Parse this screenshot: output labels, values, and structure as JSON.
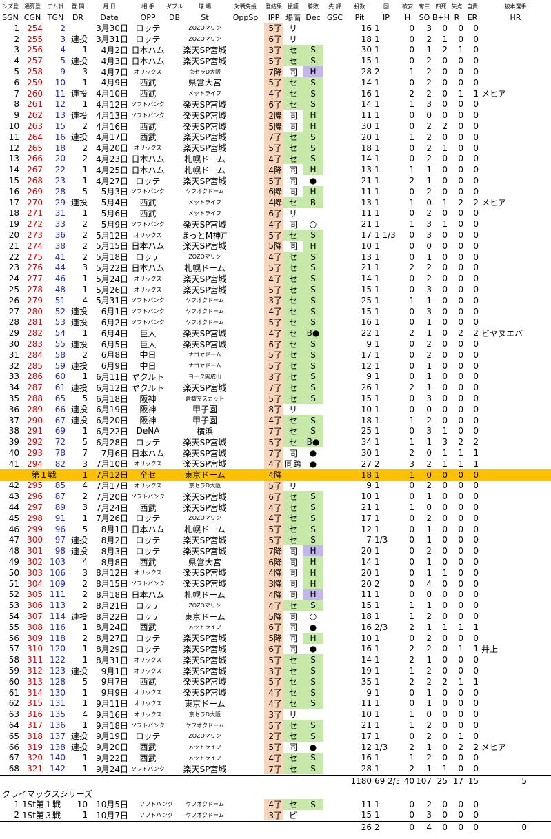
{
  "header_top": [
    "シズ登",
    "通算登",
    "チム試",
    "登 間",
    "月 日",
    "相 手",
    "ダブル",
    "球 場",
    "対戦先投",
    "登結果",
    "援護",
    "勝敗",
    "先 評",
    "投数",
    "回",
    "被安",
    "奪三",
    "四死",
    "失点",
    "自責",
    "被本選手"
  ],
  "header_bottom": [
    "SGN",
    "CGN",
    "TGN",
    "DR",
    "Date",
    "OPP",
    "DB",
    "St",
    "OppSp",
    "IPP",
    "場面",
    "Dec",
    "GSC",
    "Pit",
    "IP",
    "H",
    "SO",
    "B+H",
    "R",
    "ER",
    "HR"
  ],
  "rows": [
    [
      "1",
      "254",
      "2",
      "",
      "3月30日",
      "ロッテ",
      "",
      "ZOZOマリン",
      "",
      "5了",
      "リ",
      "",
      "",
      "16",
      "1",
      "0",
      "3",
      "0",
      "0",
      "0",
      ""
    ],
    [
      "2",
      "255",
      "3",
      "連投",
      "3月31日",
      "ロッテ",
      "",
      "ZOZOマリン",
      "",
      "6了",
      "リ",
      "",
      "",
      "18",
      "1",
      "0",
      "2",
      "1",
      "0",
      "0",
      ""
    ],
    [
      "3",
      "256",
      "4",
      "1",
      "4月2日",
      "日本ハム",
      "",
      "楽天SP宮城",
      "",
      "3了",
      "セ",
      "S",
      "",
      "30",
      "1",
      "0",
      "1",
      "2",
      "1",
      "0",
      ""
    ],
    [
      "4",
      "257",
      "5",
      "連投",
      "4月3日",
      "日本ハム",
      "",
      "楽天SP宮城",
      "",
      "5了",
      "セ",
      "S",
      "",
      "15",
      "1",
      "0",
      "2",
      "0",
      "0",
      "0",
      ""
    ],
    [
      "5",
      "258",
      "9",
      "3",
      "4月7日",
      "オリックス",
      "",
      "京セラD大阪",
      "",
      "7降",
      "同",
      "H",
      "",
      "28",
      "2",
      "1",
      "2",
      "0",
      "0",
      "0",
      ""
    ],
    [
      "6",
      "259",
      "10",
      "1",
      "4月9日",
      "西武",
      "",
      "県営大宮",
      "",
      "5了",
      "セ",
      "S",
      "",
      "14",
      "1",
      "0",
      "2",
      "0",
      "0",
      "0",
      ""
    ],
    [
      "7",
      "260",
      "11",
      "連投",
      "4月10日",
      "西武",
      "",
      "メットライフ",
      "",
      "4了",
      "セ",
      "S",
      "",
      "16",
      "1",
      "2",
      "2",
      "0",
      "1",
      "1",
      "メヒア"
    ],
    [
      "8",
      "261",
      "12",
      "1",
      "4月12日",
      "ソフトバンク",
      "",
      "楽天SP宮城",
      "",
      "6了",
      "セ",
      "S",
      "",
      "14",
      "1",
      "1",
      "3",
      "0",
      "0",
      "0",
      ""
    ],
    [
      "9",
      "262",
      "13",
      "連投",
      "4月13日",
      "ソフトバンク",
      "",
      "楽天SP宮城",
      "",
      "2降",
      "同",
      "H",
      "",
      "11",
      "1",
      "0",
      "0",
      "0",
      "0",
      "0",
      ""
    ],
    [
      "10",
      "263",
      "15",
      "2",
      "4月16日",
      "西武",
      "",
      "楽天SP宮城",
      "",
      "5降",
      "同",
      "H",
      "",
      "30",
      "1",
      "0",
      "2",
      "2",
      "0",
      "0",
      ""
    ],
    [
      "11",
      "264",
      "16",
      "連投",
      "4月17日",
      "西武",
      "",
      "楽天SP宮城",
      "",
      "7了",
      "セ",
      "S",
      "",
      "20",
      "1",
      "1",
      "2",
      "0",
      "0",
      "0",
      ""
    ],
    [
      "12",
      "265",
      "18",
      "2",
      "4月20日",
      "オリックス",
      "",
      "楽天SP宮城",
      "",
      "5了",
      "セ",
      "S",
      "",
      "18",
      "1",
      "0",
      "2",
      "1",
      "0",
      "0",
      ""
    ],
    [
      "13",
      "266",
      "20",
      "2",
      "4月23日",
      "日本ハム",
      "",
      "札幌ドーム",
      "",
      "4了",
      "セ",
      "S",
      "",
      "14",
      "1",
      "0",
      "2",
      "0",
      "0",
      "0",
      ""
    ],
    [
      "14",
      "267",
      "22",
      "1",
      "4月25日",
      "日本ハム",
      "",
      "札幌ドーム",
      "",
      "4降",
      "同",
      "H",
      "",
      "13",
      "1",
      "1",
      "1",
      "0",
      "0",
      "0",
      ""
    ],
    [
      "15",
      "268",
      "23",
      "1",
      "4月27日",
      "ロッテ",
      "",
      "楽天SP宮城",
      "",
      "5了",
      "同",
      "●",
      "",
      "21",
      "1",
      "2",
      "1",
      "0",
      "0",
      "0",
      ""
    ],
    [
      "16",
      "269",
      "28",
      "5",
      "5月3日",
      "ソフトバンク",
      "",
      "ヤフオクドーム",
      "",
      "6降",
      "同",
      "H",
      "",
      "11",
      "1",
      "0",
      "2",
      "0",
      "0",
      "0",
      ""
    ],
    [
      "17",
      "270",
      "29",
      "連投",
      "5月4日",
      "西武",
      "",
      "メットライフ",
      "",
      "4降",
      "セ",
      "B",
      "",
      "13",
      "1",
      "1",
      "0",
      "1",
      "2",
      "2",
      "メヒア"
    ],
    [
      "18",
      "271",
      "31",
      "1",
      "5月6日",
      "西武",
      "",
      "メットライフ",
      "",
      "6了",
      "リ",
      "",
      "",
      "11",
      "1",
      "0",
      "2",
      "0",
      "0",
      "0",
      ""
    ],
    [
      "19",
      "272",
      "33",
      "2",
      "5月9日",
      "ソフトバンク",
      "",
      "楽天SP宮城",
      "",
      "4了",
      "同",
      "○",
      "",
      "21",
      "1",
      "1",
      "3",
      "1",
      "0",
      "0",
      ""
    ],
    [
      "20",
      "273",
      "36",
      "2",
      "5月12日",
      "オリックス",
      "",
      "ほっとM神戸",
      "",
      "5了",
      "セ",
      "S",
      "",
      "17",
      "1 1/3",
      "0",
      "3",
      "0",
      "0",
      "0",
      ""
    ],
    [
      "21",
      "274",
      "38",
      "2",
      "5月15日",
      "日本ハム",
      "",
      "楽天SP宮城",
      "",
      "5降",
      "同",
      "H",
      "",
      "10",
      "1",
      "0",
      "0",
      "0",
      "0",
      "0",
      ""
    ],
    [
      "22",
      "275",
      "41",
      "2",
      "5月18日",
      "ロッテ",
      "",
      "ZOZOマリン",
      "",
      "4了",
      "セ",
      "S",
      "",
      "13",
      "1",
      "0",
      "1",
      "0",
      "0",
      "0",
      ""
    ],
    [
      "23",
      "276",
      "44",
      "3",
      "5月22日",
      "日本ハム",
      "",
      "札幌ドーム",
      "",
      "5了",
      "セ",
      "S",
      "",
      "21",
      "1",
      "2",
      "2",
      "0",
      "0",
      "0",
      ""
    ],
    [
      "24",
      "277",
      "46",
      "1",
      "5月24日",
      "オリックス",
      "",
      "楽天SP宮城",
      "",
      "4了",
      "セ",
      "S",
      "",
      "14",
      "1",
      "0",
      "2",
      "0",
      "0",
      "0",
      ""
    ],
    [
      "25",
      "278",
      "48",
      "1",
      "5月26日",
      "オリックス",
      "",
      "楽天SP宮城",
      "",
      "5了",
      "セ",
      "S",
      "",
      "15",
      "1",
      "0",
      "3",
      "0",
      "0",
      "0",
      ""
    ],
    [
      "26",
      "279",
      "51",
      "4",
      "5月31日",
      "ソフトバンク",
      "",
      "ヤフオクドーム",
      "",
      "3了",
      "セ",
      "S",
      "",
      "25",
      "1",
      "1",
      "1",
      "0",
      "0",
      "0",
      ""
    ],
    [
      "27",
      "280",
      "52",
      "連投",
      "6月1日",
      "ソフトバンク",
      "",
      "ヤフオクドーム",
      "",
      "4了",
      "セ",
      "S",
      "",
      "15",
      "1",
      "0",
      "3",
      "0",
      "0",
      "0",
      ""
    ],
    [
      "28",
      "281",
      "53",
      "連投",
      "6月2日",
      "ソフトバンク",
      "",
      "ヤフオクドーム",
      "",
      "5了",
      "セ",
      "S",
      "",
      "16",
      "1",
      "0",
      "1",
      "0",
      "0",
      "0",
      ""
    ],
    [
      "29",
      "282",
      "54",
      "1",
      "6月4日",
      "巨人",
      "",
      "楽天SP宮城",
      "",
      "4了",
      "セ",
      "B●",
      "",
      "22",
      "1",
      "2",
      "1",
      "0",
      "2",
      "2",
      "ビヤヌエバ"
    ],
    [
      "30",
      "283",
      "55",
      "連投",
      "6月5日",
      "巨人",
      "",
      "楽天SP宮城",
      "",
      "6了",
      "セ",
      "S",
      "",
      "9",
      "1",
      "0",
      "2",
      "0",
      "0",
      "0",
      ""
    ],
    [
      "31",
      "284",
      "58",
      "2",
      "6月8日",
      "中日",
      "",
      "ナゴヤドーム",
      "",
      "5了",
      "セ",
      "S",
      "",
      "17",
      "1",
      "0",
      "2",
      "0",
      "0",
      "0",
      ""
    ],
    [
      "32",
      "285",
      "59",
      "連投",
      "6月9日",
      "中日",
      "",
      "ナゴヤドーム",
      "",
      "5了",
      "セ",
      "S",
      "",
      "12",
      "1",
      "0",
      "1",
      "0",
      "0",
      "0",
      ""
    ],
    [
      "33",
      "286",
      "60",
      "1",
      "6月11日",
      "ヤクルト",
      "",
      "ヨーク開成山",
      "",
      "3了",
      "セ",
      "S",
      "",
      "9",
      "1",
      "0",
      "1",
      "0",
      "0",
      "0",
      ""
    ],
    [
      "34",
      "287",
      "61",
      "連投",
      "6月12日",
      "ヤクルト",
      "",
      "楽天SP宮城",
      "",
      "7了",
      "セ",
      "S",
      "",
      "26",
      "1",
      "2",
      "1",
      "0",
      "0",
      "0",
      ""
    ],
    [
      "35",
      "288",
      "65",
      "5",
      "6月18日",
      "阪神",
      "",
      "倉敷マスカット",
      "",
      "5了",
      "セ",
      "S",
      "",
      "15",
      "1",
      "0",
      "3",
      "0",
      "0",
      "0",
      ""
    ],
    [
      "36",
      "289",
      "66",
      "連投",
      "6月19日",
      "阪神",
      "",
      "甲子園",
      "",
      "8了",
      "リ",
      "",
      "",
      "10",
      "1",
      "0",
      "0",
      "0",
      "0",
      "0",
      ""
    ],
    [
      "37",
      "290",
      "67",
      "連投",
      "6月20日",
      "阪神",
      "",
      "甲子園",
      "",
      "4了",
      "セ",
      "S",
      "",
      "18",
      "1",
      "1",
      "2",
      "0",
      "0",
      "0",
      ""
    ],
    [
      "38",
      "291",
      "69",
      "1",
      "6月22日",
      "DeNA",
      "",
      "横浜",
      "",
      "7了",
      "セ",
      "S",
      "",
      "25",
      "1",
      "0",
      "3",
      "1",
      "0",
      "0",
      ""
    ],
    [
      "39",
      "292",
      "72",
      "5",
      "6月28日",
      "ロッテ",
      "",
      "楽天SP宮城",
      "",
      "5了",
      "セ",
      "B●",
      "",
      "34",
      "1",
      "1",
      "1",
      "3",
      "2",
      "2",
      ""
    ],
    [
      "40",
      "293",
      "78",
      "7",
      "7月6日",
      "日本ハム",
      "",
      "楽天SP宮城",
      "",
      "7了",
      "同",
      "●",
      "",
      "30",
      "1",
      "2",
      "0",
      "1",
      "1",
      "1",
      ""
    ],
    [
      "41",
      "294",
      "82",
      "3",
      "7月10日",
      "オリックス",
      "",
      "楽天SP宮城",
      "",
      "4了",
      "同跨",
      "●",
      "",
      "27",
      "2",
      "3",
      "2",
      "1",
      "1",
      "1",
      ""
    ]
  ],
  "allstar": [
    "第１戦",
    "1",
    "7月12日",
    "全セ",
    "東京ドーム",
    "4降",
    "18",
    "1",
    "1",
    "0",
    "0",
    "0",
    "0"
  ],
  "rows2": [
    [
      "42",
      "295",
      "85",
      "4",
      "7月17日",
      "オリックス",
      "",
      "京セラD大阪",
      "",
      "5了",
      "リ",
      "",
      "",
      "9",
      "1",
      "0",
      "2",
      "0",
      "0",
      "0",
      ""
    ],
    [
      "43",
      "296",
      "87",
      "2",
      "7月20日",
      "ソフトバンク",
      "",
      "楽天SP宮城",
      "",
      "6了",
      "セ",
      "S",
      "",
      "10",
      "1",
      "0",
      "1",
      "0",
      "0",
      "0",
      ""
    ],
    [
      "44",
      "297",
      "89",
      "3",
      "7月24日",
      "西武",
      "",
      "楽天SP宮城",
      "",
      "4了",
      "セ",
      "S",
      "",
      "21",
      "1",
      "1",
      "0",
      "0",
      "0",
      "0",
      ""
    ],
    [
      "45",
      "298",
      "91",
      "1",
      "7月26日",
      "ロッテ",
      "",
      "ZOZOマリン",
      "",
      "4了",
      "セ",
      "S",
      "",
      "17",
      "1",
      "0",
      "2",
      "0",
      "0",
      "0",
      ""
    ],
    [
      "46",
      "299",
      "96",
      "5",
      "8月1日",
      "日本ハム",
      "",
      "札幌ドーム",
      "",
      "5了",
      "セ",
      "S",
      "",
      "12",
      "1",
      "0",
      "1",
      "0",
      "0",
      "0",
      ""
    ],
    [
      "47",
      "300",
      "97",
      "連投",
      "8月2日",
      "ロッテ",
      "",
      "楽天SP宮城",
      "",
      "5了",
      "セ",
      "S",
      "",
      "7",
      "1/3",
      "0",
      "1",
      "0",
      "0",
      "0",
      ""
    ],
    [
      "48",
      "301",
      "98",
      "連投",
      "8月3日",
      "ロッテ",
      "",
      "楽天SP宮城",
      "",
      "7降",
      "同",
      "H",
      "",
      "20",
      "1",
      "0",
      "2",
      "0",
      "0",
      "0",
      ""
    ],
    [
      "49",
      "302",
      "103",
      "4",
      "8月8日",
      "西武",
      "",
      "県営大宮",
      "",
      "6降",
      "同",
      "H",
      "",
      "14",
      "1",
      "0",
      "1",
      "0",
      "0",
      "0",
      ""
    ],
    [
      "50",
      "303",
      "106",
      "3",
      "8月12日",
      "オリックス",
      "",
      "楽天SP宮城",
      "",
      "4降",
      "同",
      "H",
      "",
      "20",
      "1",
      "0",
      "1",
      "1",
      "0",
      "0",
      ""
    ],
    [
      "51",
      "304",
      "109",
      "2",
      "8月15日",
      "ソフトバンク",
      "",
      "楽天SP宮城",
      "",
      "3降",
      "同",
      "H",
      "",
      "20",
      "2",
      "0",
      "4",
      "0",
      "0",
      "0",
      ""
    ],
    [
      "52",
      "305",
      "111",
      "2",
      "8月18日",
      "日本ハム",
      "",
      "札幌ドーム",
      "",
      "4降",
      "同",
      "H",
      "",
      "11",
      "1",
      "0",
      "0",
      "0",
      "0",
      "0",
      ""
    ],
    [
      "53",
      "306",
      "113",
      "2",
      "8月21日",
      "ロッテ",
      "",
      "ZOZOマリン",
      "",
      "4了",
      "セ",
      "S",
      "",
      "15",
      "1",
      "1",
      "1",
      "0",
      "0",
      "0",
      ""
    ],
    [
      "54",
      "307",
      "114",
      "連投",
      "8月22日",
      "ロッテ",
      "",
      "東京ドーム",
      "",
      "5降",
      "同",
      "○",
      "",
      "18",
      "1",
      "1",
      "2",
      "0",
      "0",
      "0",
      ""
    ],
    [
      "55",
      "308",
      "116",
      "1",
      "8月24日",
      "西武",
      "",
      "メットライフ",
      "",
      "6了",
      "同",
      "●",
      "",
      "16",
      "2/3",
      "2",
      "1",
      "1",
      "1",
      "1",
      ""
    ],
    [
      "56",
      "309",
      "118",
      "2",
      "8月27日",
      "ロッテ",
      "",
      "楽天SP宮城",
      "",
      "5降",
      "同",
      "H",
      "",
      "10",
      "1",
      "0",
      "2",
      "0",
      "0",
      "0",
      ""
    ],
    [
      "57",
      "310",
      "120",
      "1",
      "8月29日",
      "ロッテ",
      "",
      "楽天SP宮城",
      "",
      "6了",
      "同",
      "●",
      "",
      "16",
      "1",
      "2",
      "2",
      "0",
      "1",
      "1",
      "井上"
    ],
    [
      "58",
      "311",
      "122",
      "1",
      "8月31日",
      "オリックス",
      "",
      "楽天SP宮城",
      "",
      "5了",
      "セ",
      "S",
      "",
      "14",
      "1",
      "2",
      "1",
      "0",
      "0",
      "0",
      ""
    ],
    [
      "59",
      "312",
      "123",
      "連投",
      "9月1日",
      "オリックス",
      "",
      "楽天SP宮城",
      "",
      "3了",
      "セ",
      "S",
      "",
      "19",
      "1",
      "1",
      "2",
      "0",
      "0",
      "0",
      ""
    ],
    [
      "60",
      "313",
      "128",
      "5",
      "9月7日",
      "西武",
      "",
      "楽天SP宮城",
      "",
      "5了",
      "セ",
      "S",
      "",
      "35",
      "1",
      "2",
      "2",
      "2",
      "1",
      "1",
      ""
    ],
    [
      "61",
      "314",
      "130",
      "1",
      "9月9日",
      "オリックス",
      "",
      "楽天SP宮城",
      "",
      "4了",
      "セ",
      "S",
      "",
      "9",
      "1",
      "0",
      "1",
      "0",
      "0",
      "0",
      ""
    ],
    [
      "62",
      "315",
      "131",
      "1",
      "9月11日",
      "オリックス",
      "",
      "東京ドーム",
      "",
      "4了",
      "セ",
      "S",
      "",
      "11",
      "1",
      "0",
      "1",
      "0",
      "0",
      "0",
      ""
    ],
    [
      "63",
      "316",
      "135",
      "4",
      "9月16日",
      "オリックス",
      "",
      "京セラD大阪",
      "",
      "3了",
      "リ",
      "",
      "",
      "10",
      "1",
      "1",
      "0",
      "0",
      "0",
      "0",
      ""
    ],
    [
      "64",
      "317",
      "136",
      "1",
      "9月18日",
      "ソフトバンク",
      "",
      "ヤフオクドーム",
      "",
      "5了",
      "セ",
      "S",
      "",
      "21",
      "1",
      "1",
      "2",
      "0",
      "0",
      "0",
      ""
    ],
    [
      "65",
      "318",
      "137",
      "連投",
      "9月19日",
      "ロッテ",
      "",
      "ZOZOマリン",
      "",
      "2了",
      "セ",
      "S",
      "",
      "17",
      "1",
      "0",
      "2",
      "0",
      "1",
      "0",
      ""
    ],
    [
      "66",
      "319",
      "138",
      "連投",
      "9月20日",
      "西武",
      "",
      "メットライフ",
      "",
      "5了",
      "同",
      "●",
      "",
      "12",
      "1/3",
      "2",
      "1",
      "0",
      "2",
      "2",
      "メヒア"
    ],
    [
      "67",
      "320",
      "140",
      "1",
      "9月22日",
      "西武",
      "",
      "メットライフ",
      "",
      "4了",
      "セ",
      "S",
      "",
      "16",
      "1",
      "1",
      "2",
      "0",
      "0",
      "0",
      ""
    ],
    [
      "68",
      "321",
      "142",
      "1",
      "9月24日",
      "ソフトバンク",
      "",
      "楽天SP宮城",
      "",
      "7了",
      "セ",
      "S",
      "",
      "28",
      "1",
      "2",
      "1",
      "1",
      "0",
      "0",
      ""
    ]
  ],
  "totals": [
    "1180",
    "69 2/3",
    "40",
    "107",
    "25",
    "17",
    "15",
    "5"
  ],
  "climax_title": "クライマックスシリーズ",
  "climax_rows": [
    [
      "1",
      "1St第１戦",
      "10",
      "10月5日",
      "ソフトバンク",
      "",
      "ヤフオクドーム",
      "",
      "4了",
      "セ",
      "S",
      "",
      "11",
      "1",
      "0",
      "2",
      "0",
      "0",
      "0",
      ""
    ],
    [
      "2",
      "1St第３戦",
      "1",
      "10月7日",
      "ソフトバンク",
      "",
      "ヤフオクドーム",
      "",
      "3了",
      "ビ",
      "",
      "",
      "15",
      "1",
      "0",
      "3",
      "0",
      "0",
      "0",
      ""
    ]
  ],
  "climax_totals": [
    "26",
    "2",
    "0",
    "4",
    "0",
    "0",
    "0",
    "0"
  ],
  "colors": {
    "peach": "#f8d4b8",
    "green": "#c6e8a8",
    "lavender": "#c2b6ea",
    "allstar_bg": "#ffc000",
    "red_text": "#e00000",
    "blue_text": "#1a2ccc"
  }
}
